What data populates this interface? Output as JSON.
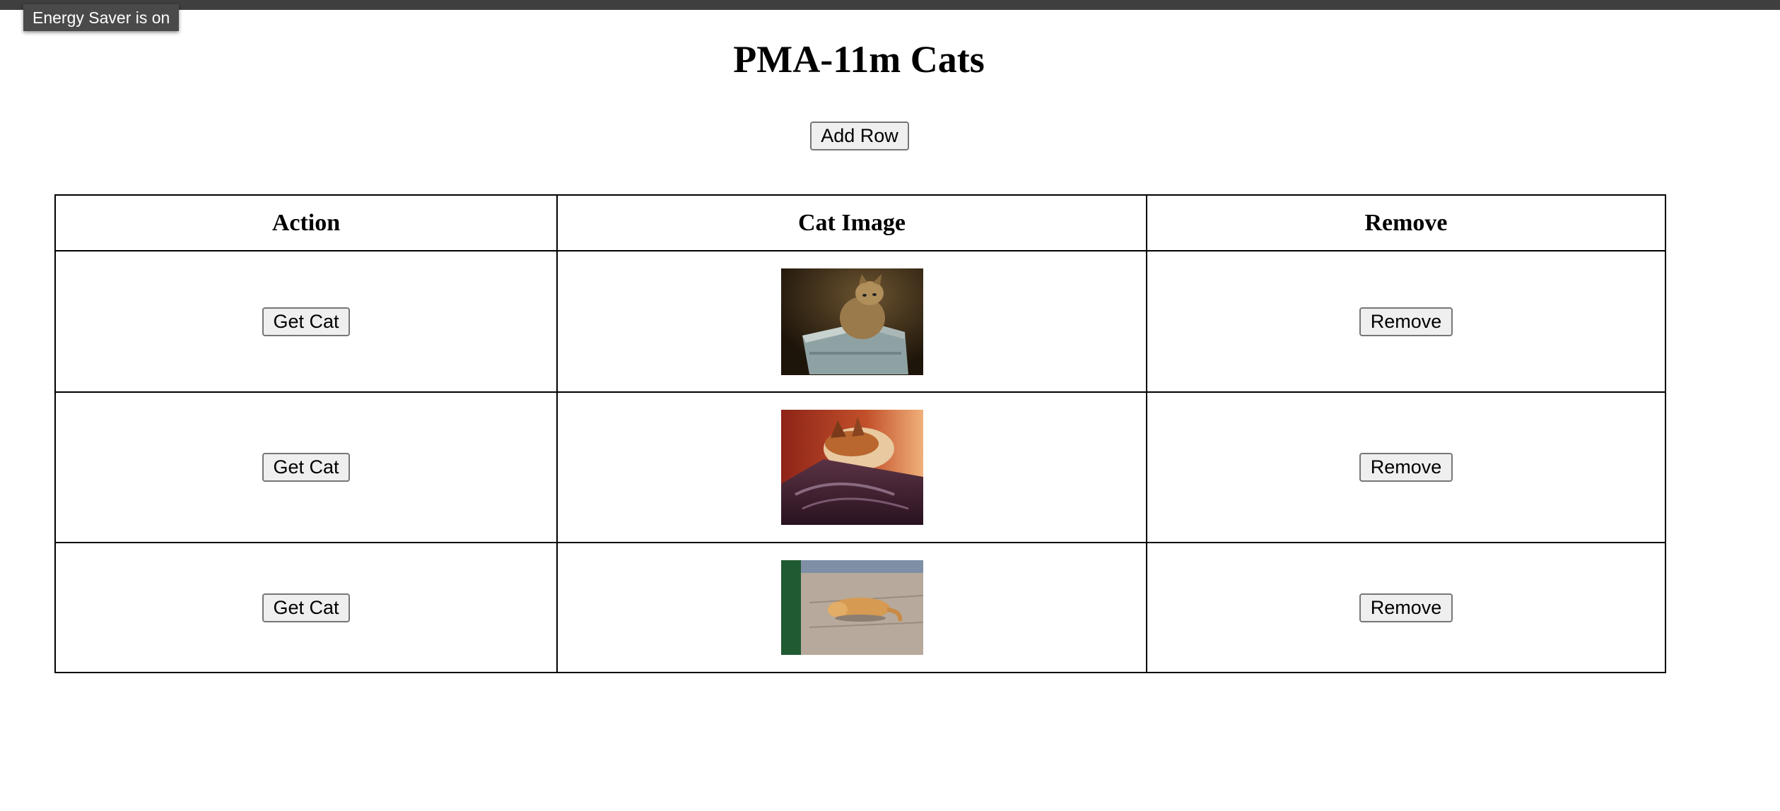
{
  "system": {
    "energy_saver_toast": "Energy Saver is on"
  },
  "page": {
    "title": "PMA-11m Cats",
    "add_row_label": "Add Row"
  },
  "table": {
    "headers": [
      "Action",
      "Cat Image",
      "Remove"
    ],
    "rows": [
      {
        "action_label": "Get Cat",
        "remove_label": "Remove"
      },
      {
        "action_label": "Get Cat",
        "remove_label": "Remove"
      },
      {
        "action_label": "Get Cat",
        "remove_label": "Remove"
      }
    ]
  }
}
